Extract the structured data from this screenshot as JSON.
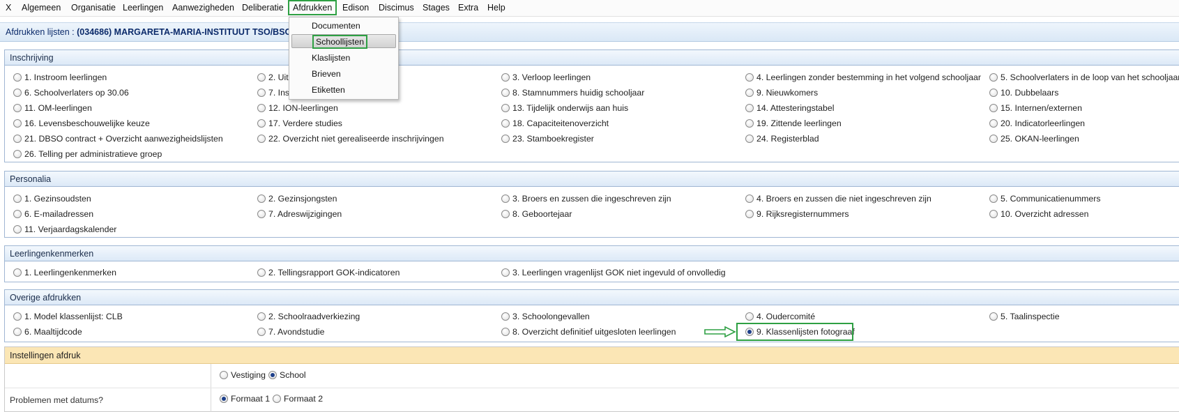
{
  "menubar": {
    "items": [
      "X",
      "Algemeen",
      "Organisatie",
      "Leerlingen",
      "Aanwezigheden",
      "Deliberatie",
      "Afdrukken",
      "Edison",
      "Discimus",
      "Stages",
      "Extra",
      "Help"
    ]
  },
  "dropdown": {
    "items": [
      "Documenten",
      "Schoollijsten",
      "Klaslijsten",
      "Brieven",
      "Etiketten"
    ]
  },
  "titlebar": {
    "label": "Afdrukken lijsten : ",
    "value": "(034686) MARGARETA-MARIA-INSTITUUT TSO/BSO"
  },
  "sections": [
    {
      "title": "Inschrijving",
      "options": [
        "1. Instroom leerlingen",
        "2. Uits",
        "3. Verloop leerlingen",
        "4. Leerlingen zonder bestemming in het volgend schooljaar",
        "5. Schoolverlaters in de loop van het schooljaar",
        "6. Schoolverlaters op 30.06",
        "7. Ins",
        "8. Stamnummers huidig schooljaar",
        "9. Nieuwkomers",
        "10. Dubbelaars",
        "11. OM-leerlingen",
        "12. ION-leerlingen",
        "13. Tijdelijk onderwijs aan huis",
        "14. Attesteringstabel",
        "15. Internen/externen",
        "16. Levensbeschouwelijke keuze",
        "17. Verdere studies",
        "18. Capaciteitenoverzicht",
        "19. Zittende leerlingen",
        "20. Indicatorleerlingen",
        "21. DBSO contract + Overzicht aanwezigheidslijsten",
        "22. Overzicht niet gerealiseerde inschrijvingen",
        "23. Stamboekregister",
        "24. Registerblad",
        "25. OKAN-leerlingen",
        "26. Telling per administratieve groep"
      ]
    },
    {
      "title": "Personalia",
      "options": [
        "1. Gezinsoudsten",
        "2. Gezinsjongsten",
        "3. Broers en zussen die ingeschreven zijn",
        "4. Broers en zussen die niet ingeschreven zijn",
        "5. Communicatienummers",
        "6. E-mailadressen",
        "7. Adreswijzigingen",
        "8. Geboortejaar",
        "9. Rijksregisternummers",
        "10. Overzicht adressen",
        "11. Verjaardagskalender"
      ]
    },
    {
      "title": "Leerlingenkenmerken",
      "options": [
        "1. Leerlingenkenmerken",
        "2. Tellingsrapport GOK-indicatoren",
        "3. Leerlingen vragenlijst GOK niet ingevuld of onvolledig"
      ]
    },
    {
      "title": "Overige afdrukken",
      "options": [
        "1. Model klassenlijst: CLB",
        "2. Schoolraadverkiezing",
        "3. Schoolongevallen",
        "4. Oudercomité",
        "5. Taalinspectie",
        "6. Maaltijdcode",
        "7. Avondstudie",
        "8. Overzicht definitief uitgesloten leerlingen",
        "9. Klassenlijsten fotograaf"
      ],
      "selected": "9. Klassenlijsten fotograaf"
    }
  ],
  "settings": {
    "title": "Instellingen afdruk",
    "row1": {
      "label": "",
      "options": [
        "Vestiging",
        "School"
      ],
      "selected": "School"
    },
    "row2": {
      "label": "Problemen met datums?",
      "options": [
        "Formaat 1",
        "Formaat 2"
      ],
      "selected": "Formaat 1"
    }
  },
  "colors": {
    "highlight": "#2ea043",
    "section_header": "#dce9f7",
    "settings_header": "#fbe6b5",
    "title_text": "#0b2a6a"
  }
}
